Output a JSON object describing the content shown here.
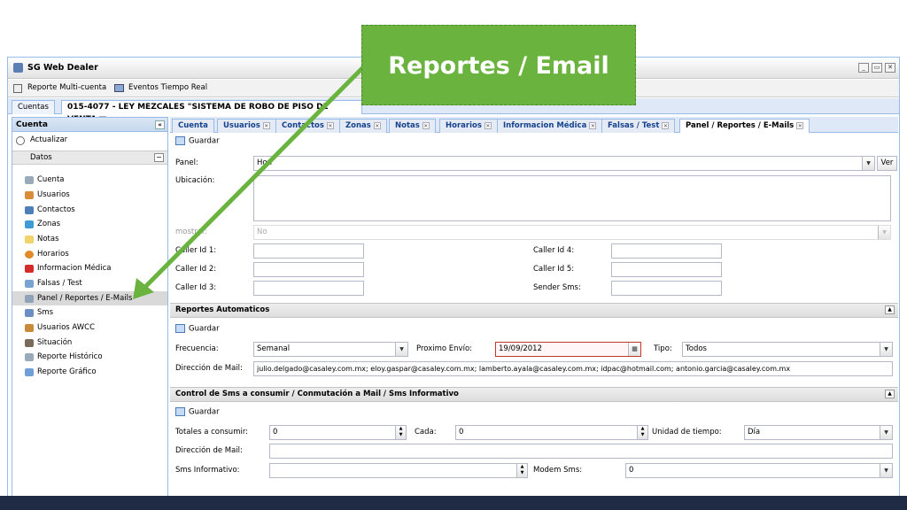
{
  "callout": {
    "text": "Reportes / Email"
  },
  "window": {
    "title": "SG Web Dealer",
    "toolbar": [
      "Reporte Multi-cuenta",
      "Eventos Tiempo Real"
    ],
    "tabs": {
      "cuentas": "Cuentas",
      "account": "015-4077 - LEY MEZCALES \"SISTEMA DE ROBO DE PISO DE VENTA"
    }
  },
  "sidebar": {
    "title": "Cuenta",
    "refresh": "Actualizar",
    "group": "Datos",
    "items": [
      "Cuenta",
      "Usuarios",
      "Contactos",
      "Zonas",
      "Notas",
      "Horarios",
      "Informacion Médica",
      "Falsas / Test",
      "Panel / Reportes / E-Mails",
      "Sms",
      "Usuarios AWCC",
      "Situación",
      "Reporte Histórico",
      "Reporte Gráfico"
    ],
    "selected_index": 8
  },
  "inner_tabs": [
    "Cuenta",
    "Usuarios",
    "Contactos",
    "Zonas",
    "Notas",
    "Horarios",
    "Informacion Médica",
    "Falsas / Test",
    "Panel / Reportes / E-Mails"
  ],
  "panel": {
    "guardar": "Guardar",
    "panel_label": "Panel:",
    "panel_value": "Hon",
    "ver": "Ver",
    "ubicacion_label": "Ubicación:",
    "mostrar_label": "mostrar:",
    "mostrar_value": "No",
    "caller_left": [
      "Caller Id 1:",
      "Caller Id 2:",
      "Caller Id 3:"
    ],
    "caller_right": [
      "Caller Id 4:",
      "Caller Id 5:",
      "Sender Sms:"
    ]
  },
  "reportes": {
    "title": "Reportes Automaticos",
    "guardar": "Guardar",
    "frecuencia_label": "Frecuencia:",
    "frecuencia_value": "Semanal",
    "proximo_label": "Proximo Envío:",
    "proximo_value": "19/09/2012",
    "tipo_label": "Tipo:",
    "tipo_value": "Todos",
    "mail_label": "Dirección de Mail:",
    "mail_value": "julio.delgado@casaley.com.mx; eloy.gaspar@casaley.com.mx; lamberto.ayala@casaley.com.mx; idpac@hotmail.com; antonio.garcia@casaley.com.mx"
  },
  "sms": {
    "title": "Control de Sms a consumir / Conmutación a Mail / Sms Informativo",
    "guardar": "Guardar",
    "totales_label": "Totales a consumir:",
    "totales_value": "0",
    "cada_label": "Cada:",
    "cada_value": "0",
    "unidad_label": "Unidad de tiempo:",
    "unidad_value": "Día",
    "mail_label": "Dirección de Mail:",
    "informativo_label": "Sms Informativo:",
    "modem_label": "Modem Sms:",
    "modem_value": "0"
  }
}
